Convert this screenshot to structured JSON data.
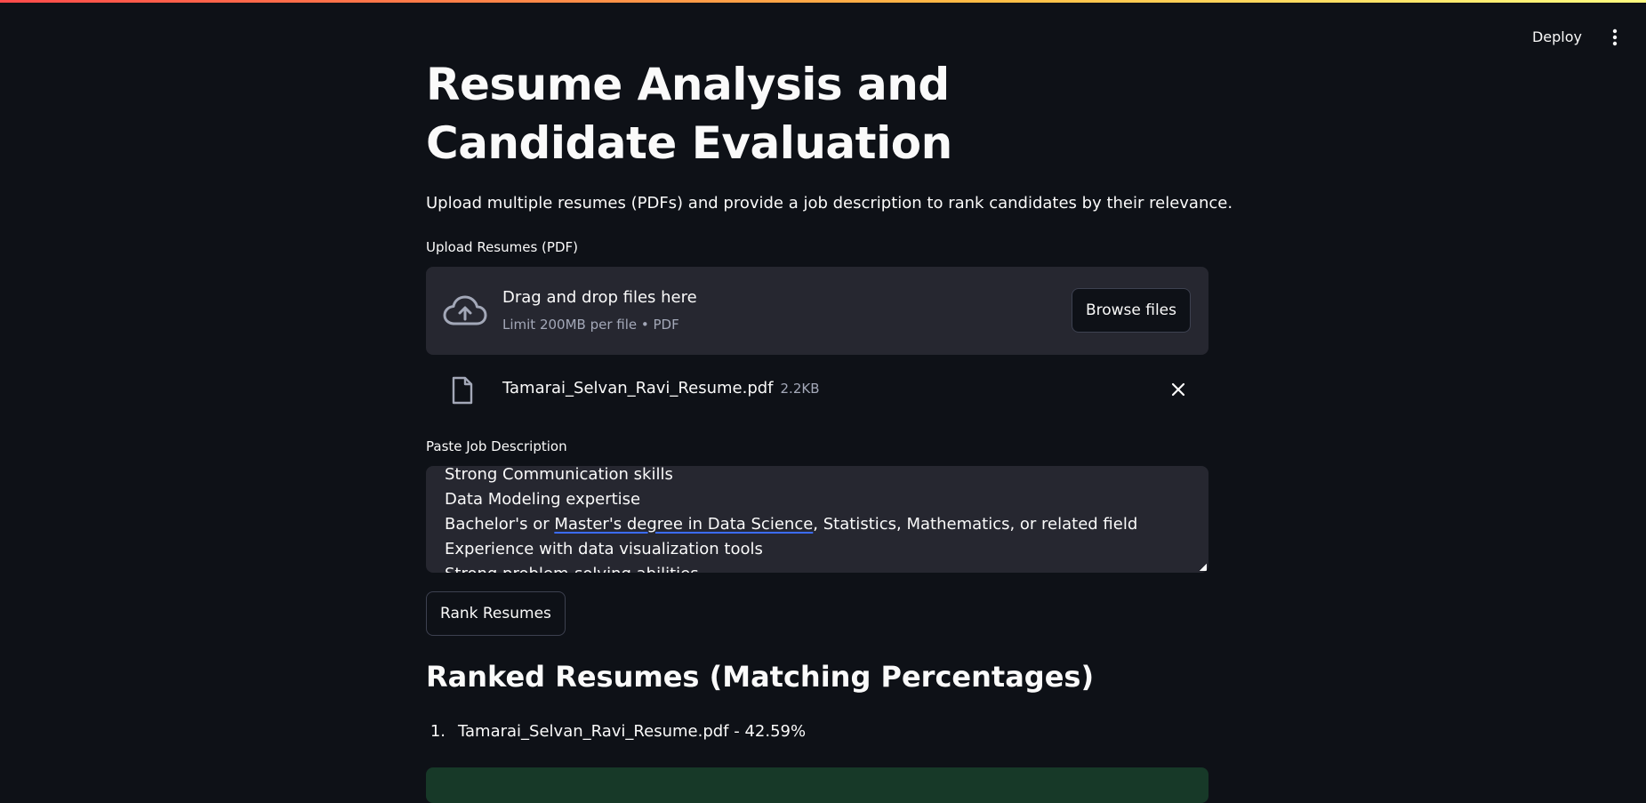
{
  "header": {
    "deploy_label": "Deploy",
    "menu_icon": "kebab-menu-icon"
  },
  "page": {
    "title": "Resume Analysis and Candidate Evaluation",
    "subtitle": "Upload multiple resumes (PDFs) and provide a job description to rank candidates by their relevance."
  },
  "uploader": {
    "label": "Upload Resumes (PDF)",
    "drop_title": "Drag and drop files here",
    "limit_text": "Limit 200MB per file • PDF",
    "browse_label": "Browse files",
    "icon": "cloud-upload-icon"
  },
  "uploaded_file": {
    "name": "Tamarai_Selvan_Ravi_Resume.pdf",
    "size": "2.2KB",
    "icon": "file-icon",
    "remove_icon": "close-icon"
  },
  "job_description": {
    "label": "Paste Job Description",
    "lines": [
      "Strong Communication skills",
      "Data Modeling expertise",
      "Bachelor's or Master's degree in Data Science, Statistics, Mathematics, or related field",
      "Experience with data visualization tools",
      "Strong problem-solving abilities"
    ],
    "line3_prefix": "Bachelor's or ",
    "line3_underlined": "Master's degree in Data Science",
    "line3_suffix": ", Statistics, Mathematics, or related field"
  },
  "actions": {
    "rank_label": "Rank Resumes"
  },
  "results": {
    "heading": "Ranked Resumes (Matching Percentages)",
    "items": [
      {
        "num": "1.",
        "text": "Tamarai_Selvan_Ravi_Resume.pdf - 42.59%"
      }
    ]
  },
  "colors": {
    "background": "#0e1117",
    "panel": "#262730",
    "text": "#fafafa",
    "muted": "#a3a8b8",
    "success_bg": "#173928"
  }
}
